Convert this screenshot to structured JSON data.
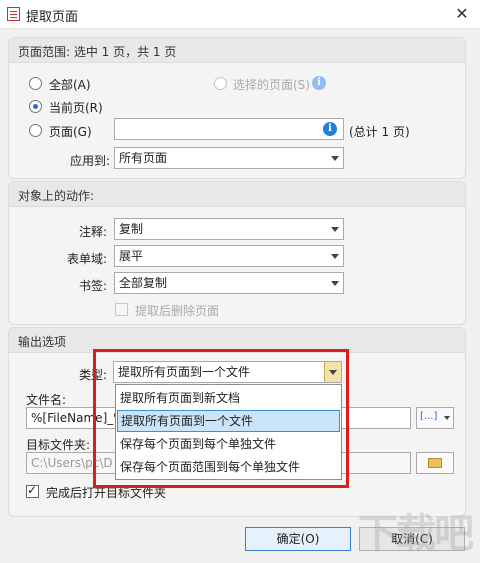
{
  "window": {
    "title": "提取页面",
    "close_glyph": "✕"
  },
  "page_range": {
    "header": "页面范围: 选中 1 页，共 1 页",
    "all_label": "全部(A)",
    "selected_pages_label": "选择的页面(S)",
    "current_page_label": "当前页(R)",
    "pages_label": "页面(G)",
    "pages_value": "",
    "total_label": "(总计 1 页)",
    "apply_to_label": "应用到:",
    "apply_to_value": "所有页面"
  },
  "actions": {
    "header": "对象上的动作:",
    "annotation_label": "注释:",
    "annotation_value": "复制",
    "form_field_label": "表单域:",
    "form_field_value": "展平",
    "bookmark_label": "书签:",
    "bookmark_value": "全部复制",
    "delete_after_label": "提取后删除页面"
  },
  "output": {
    "header": "输出选项",
    "type_label": "类型:",
    "type_value": "提取所有页面到一个文件",
    "type_options": [
      "提取所有页面到新文档",
      "提取所有页面到一个文件",
      "保存每个页面到每个单独文件",
      "保存每个页面范围到每个单独文件"
    ],
    "filename_label": "文件名:",
    "filename_value": "%[FileName]_%",
    "folder_label": "目标文件夹:",
    "folder_value": "C:\\Users\\pc\\D",
    "open_after_label": "完成后打开目标文件夹"
  },
  "buttons": {
    "ok": "确定(O)",
    "cancel": "取消(C)"
  },
  "watermark": "下载吧",
  "icons": {
    "info": "i",
    "macro_button": "[...]"
  },
  "colors": {
    "highlight_box": "#d61f1f",
    "selected_option_bg": "#cce4f7",
    "info_icon": "#1f7fe0"
  }
}
